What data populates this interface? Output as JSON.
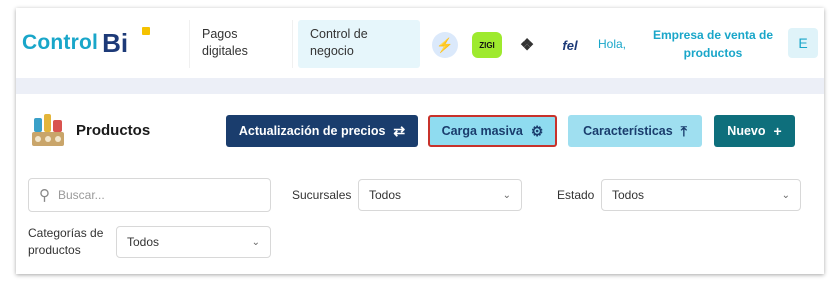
{
  "header": {
    "logo_text": "Control",
    "logo_bi": "Bi",
    "tabs": [
      {
        "label": "Pagos digitales"
      },
      {
        "label": "Control de negocio"
      }
    ],
    "apps": [
      {
        "icon": "bolt-icon",
        "glyph": "⚡"
      },
      {
        "icon": "zigi-icon",
        "glyph": "ZIGI"
      },
      {
        "icon": "diamond-icon",
        "glyph": "❖"
      },
      {
        "icon": "fel-icon",
        "glyph": "fel"
      }
    ],
    "greeting": "Hola,",
    "company": "Empresa de venta de productos",
    "avatar_initial": "E"
  },
  "page": {
    "title": "Productos"
  },
  "toolbar": {
    "precios_label": "Actualización de precios",
    "carga_label": "Carga masiva",
    "caracteristicas_label": "Características",
    "nuevo_label": "Nuevo"
  },
  "filters": {
    "search_placeholder": "Buscar...",
    "sucursales_label": "Sucursales",
    "sucursales_value": "Todos",
    "estado_label": "Estado",
    "estado_value": "Todos",
    "categorias_label_1": "Categorías de",
    "categorias_label_2": "productos",
    "categorias_value": "Todos"
  },
  "colors": {
    "brand_teal": "#19a6c9",
    "brand_navy": "#1a3d6d",
    "highlight_border": "#c8322b"
  }
}
